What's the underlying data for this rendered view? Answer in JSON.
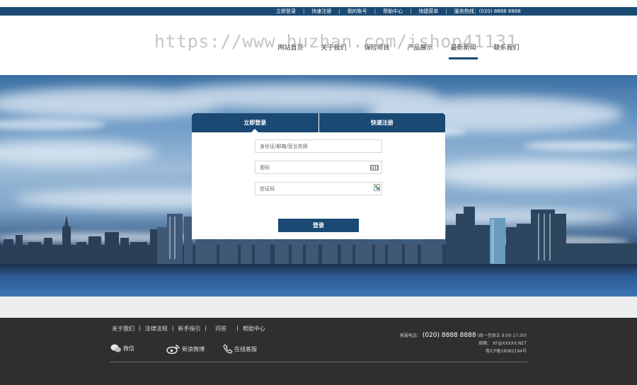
{
  "topbar": {
    "links": [
      "立即登录",
      "快速注册",
      "我的账号",
      "帮助中心",
      "快捷菜单"
    ],
    "hotline_label": "服务热线：",
    "hotline": "(020) 8888 8888"
  },
  "watermark": "https://www.huzhan.com/ishop41131",
  "nav": {
    "items": [
      "网站首页",
      "关于我们",
      "保险项目",
      "产品展示",
      "最新新闻",
      "联系我们"
    ],
    "active_index": 4
  },
  "login": {
    "tabs": [
      "立即登录",
      "快速注册"
    ],
    "active_tab": 0,
    "account_placeholder": "身份证/邮箱/营业执照",
    "password_placeholder": "密码",
    "captcha_placeholder": "验证码",
    "submit_label": "登录"
  },
  "footer": {
    "links": [
      "关于我们",
      "法律法规",
      "新手指引",
      "问答",
      "帮助中心"
    ],
    "social": [
      "微信",
      "新浪微博",
      "在线客服"
    ],
    "phone_label": "客服电话：",
    "phone": "(020) 8888 8888",
    "hours": "(周一至周五 9:00-17:30)",
    "email_label": "邮箱：",
    "email": "KF@XXXXX.NET",
    "icp": "粤ICP备18082194号"
  },
  "colors": {
    "brand": "#1a4a73",
    "footer_bg": "#2f2f2f",
    "gap_bg": "#edeef0"
  }
}
